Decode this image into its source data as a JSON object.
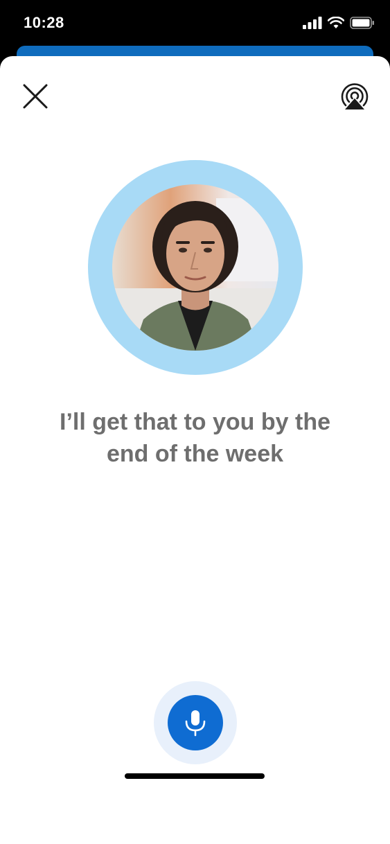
{
  "status_bar": {
    "time": "10:28",
    "icons": [
      "signal-icon",
      "wifi-icon",
      "battery-icon"
    ]
  },
  "colors": {
    "accent": "#0f6cbd",
    "mic_button": "#0f6cd2",
    "avatar_ring": "#a8daf6",
    "mic_halo": "#e8f0fb",
    "caption_text": "#6e6e6e"
  },
  "header": {
    "close_icon": "close-icon",
    "airplay_icon": "airplay-icon"
  },
  "speaker": {
    "avatar": "person-photo"
  },
  "caption": {
    "line1": "I’ll get that to you by the",
    "line2": "end of the week"
  },
  "controls": {
    "mic_icon": "microphone-icon"
  }
}
